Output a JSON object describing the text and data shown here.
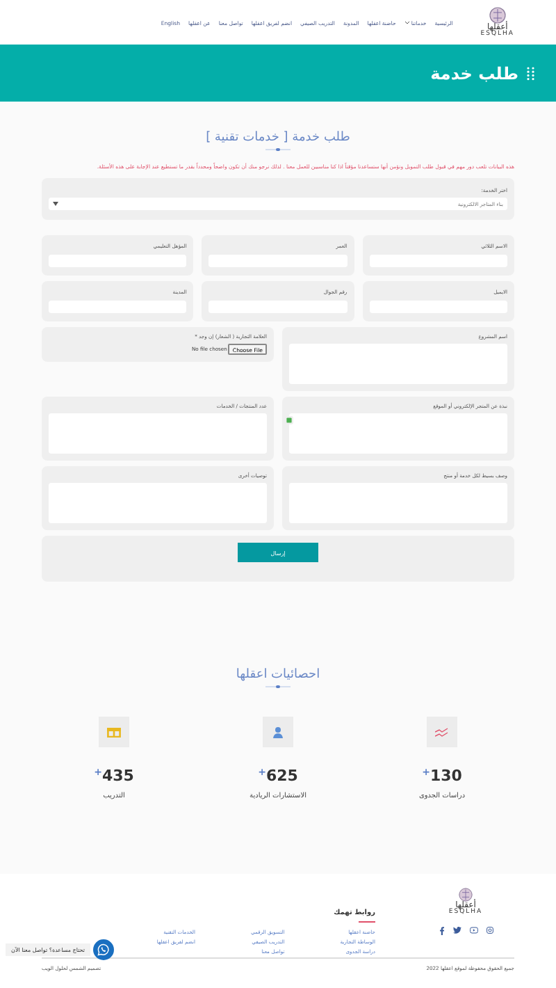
{
  "header": {
    "logo_text": "ESQLHA",
    "logo_arabic": "أعقلها",
    "nav": [
      {
        "label": "الرئيسية",
        "dropdown": false
      },
      {
        "label": "خدماتنا",
        "dropdown": true
      },
      {
        "label": "حاضنة اعقلها",
        "dropdown": false
      },
      {
        "label": "المدونة",
        "dropdown": false
      },
      {
        "label": "التدريب الصيفي",
        "dropdown": false
      },
      {
        "label": "انضم لفريق اعقلها",
        "dropdown": false
      },
      {
        "label": "تواصل معنا",
        "dropdown": false
      },
      {
        "label": "عن اعقلها",
        "dropdown": false
      },
      {
        "label": "English",
        "dropdown": false
      }
    ]
  },
  "banner": {
    "title": "طلب خدمة"
  },
  "form": {
    "title": "طلب خدمة [ خدمات تقنية ]",
    "notice": "هذه البيانات تلعب دور مهم في قبول طلب التمويل ونؤمن أنها ستساعدنا مؤقتاً اذا كنا مناسبين للعمل معنا . لذلك نرجو منك أن تكون واضحاً ومحدداً بقدر ما تستطيع عند الإجابة على هذه الأسئلة.",
    "service": {
      "label": "اختر الخدمة:",
      "value": "بناء المتاجر الالكترونية"
    },
    "fields": [
      {
        "label": "الاسم الثلاثي"
      },
      {
        "label": "العمر"
      },
      {
        "label": "المؤهل التعليمي"
      },
      {
        "label": "الايميل"
      },
      {
        "label": "رقم الجوال"
      },
      {
        "label": "المدينة"
      }
    ],
    "large_fields": [
      {
        "label": "اسم المشروع",
        "kind": "textarea"
      },
      {
        "label": "العلامة التجارية ( الشعار) إن وجد *",
        "kind": "file",
        "button": "Choose File",
        "status": "No file chosen"
      },
      {
        "label": "نبذة عن المتجر الإلكتروني أو الموقع",
        "kind": "textarea"
      },
      {
        "label": "عدد المنتجات / الخدمات",
        "kind": "textarea"
      },
      {
        "label": "وصف بسيط لكل خدمة أو منتج",
        "kind": "textarea"
      },
      {
        "label": "توصيات أخرى",
        "kind": "textarea"
      }
    ],
    "submit": "إرسال"
  },
  "stats": {
    "title": "احصائيات اعقلها",
    "items": [
      {
        "number": "130",
        "plus": "+",
        "label": "دراسات الجدوى",
        "kind": "chart",
        "color": "#e0506a"
      },
      {
        "number": "625",
        "plus": "+",
        "label": "الاستشارات الريادية",
        "kind": "person",
        "color": "#5b8fd6"
      },
      {
        "number": "435",
        "plus": "+",
        "label": "التدريب",
        "kind": "book",
        "color": "#e8b820"
      }
    ]
  },
  "footer": {
    "logo_text": "ESQLHA",
    "logo_arabic": "أعقلها",
    "links_title": "روابط تهمك",
    "link_columns": [
      [
        "حاضنة اعقلها",
        "الوساطة التجارية",
        "دراسة الجدوى"
      ],
      [
        "التسويق الرقمي",
        "التدريب الصيفي",
        "تواصل معنا"
      ],
      [
        "الخدمات التقنية",
        "انضم لفريق اعقلها"
      ]
    ],
    "copyright": "جميع الحقوق محفوظة لموقع اعقلها 2022",
    "credit": "تصميم الشمس لحلول الويب",
    "chat_bubble": "تحتاج مساعدة؟ تواصل معنا الآن"
  }
}
